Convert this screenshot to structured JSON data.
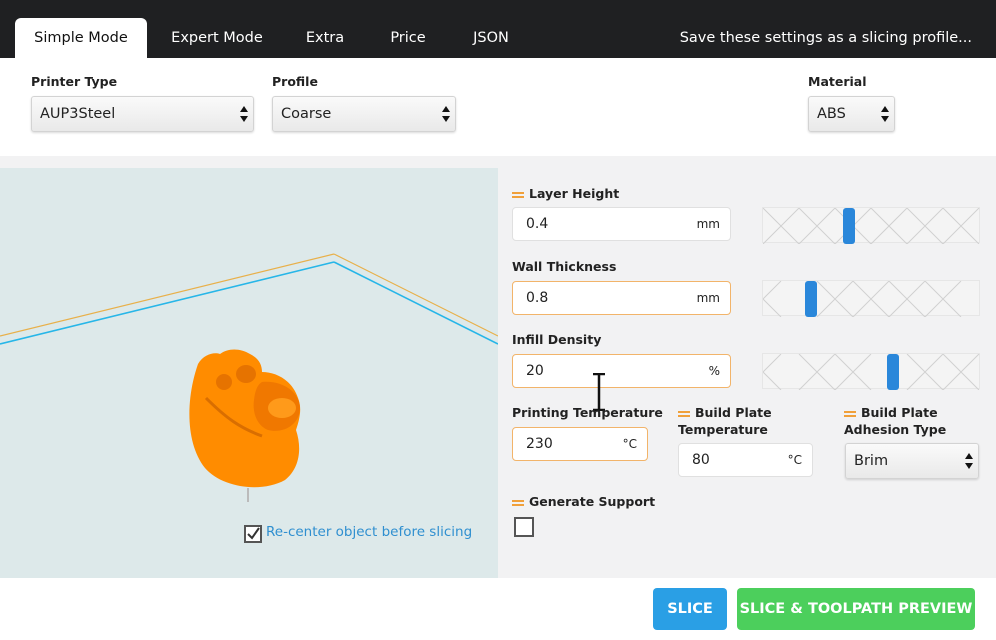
{
  "tabs": [
    {
      "label": "Simple Mode",
      "active": true
    },
    {
      "label": "Expert Mode"
    },
    {
      "label": "Extra"
    },
    {
      "label": "Price"
    },
    {
      "label": "JSON"
    }
  ],
  "save_link": "Save these settings as a slicing profile...",
  "printer_type": {
    "label": "Printer Type",
    "value": "AUP3Steel"
  },
  "profile": {
    "label": "Profile",
    "value": "Coarse"
  },
  "material": {
    "label": "Material",
    "value": "ABS"
  },
  "viewport": {
    "recenter_label": "Re-center object before slicing",
    "recenter_checked": true
  },
  "settings": {
    "layer_height": {
      "label": "Layer Height",
      "value": "0.4",
      "unit": "mm",
      "slider_fraction": 0.4
    },
    "wall_thickness": {
      "label": "Wall Thickness",
      "value": "0.8",
      "unit": "mm",
      "slider_fraction": 0.22
    },
    "infill_density": {
      "label": "Infill Density",
      "value": "20",
      "unit": "%",
      "slider_fraction": 0.6
    },
    "printing_temperature": {
      "label": "Printing Temperature",
      "value": "230",
      "unit": "°C"
    },
    "build_plate_temperature": {
      "label_line1": "Build Plate",
      "label_line2": "Temperature",
      "value": "80",
      "unit": "°C"
    },
    "adhesion_type": {
      "label_line1": "Build Plate",
      "label_line2": "Adhesion Type",
      "value": "Brim"
    },
    "generate_support": {
      "label": "Generate Support",
      "checked": false
    }
  },
  "buttons": {
    "slice": "SLICE",
    "preview": "SLICE & TOOLPATH PREVIEW"
  },
  "colors": {
    "accent_blue": "#2a9fe5",
    "accent_green": "#4ccf5c",
    "model_orange": "#ff8c00",
    "swap_icon": "#f0a03a"
  },
  "icons": [
    "swap-icon",
    "checkbox-checked-icon",
    "select-arrows-icon",
    "text-cursor-icon"
  ]
}
